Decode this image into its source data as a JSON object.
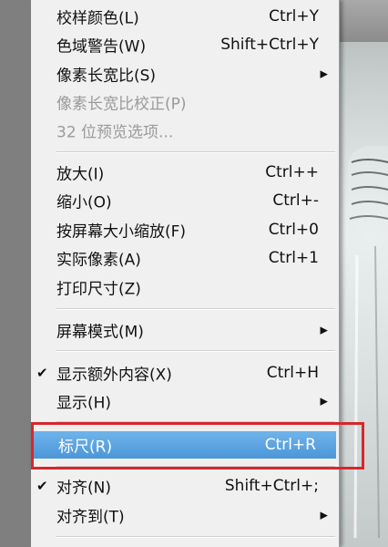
{
  "menu": {
    "items": [
      {
        "label": "校样颜色(L)",
        "shortcut": "Ctrl+Y",
        "enabled": true
      },
      {
        "label": "色域警告(W)",
        "shortcut": "Shift+Ctrl+Y",
        "enabled": true
      },
      {
        "label": "像素长宽比(S)",
        "shortcut": "",
        "submenu": true,
        "enabled": true
      },
      {
        "label": "像素长宽比校正(P)",
        "shortcut": "",
        "enabled": false
      },
      {
        "label": "32 位预览选项...",
        "shortcut": "",
        "enabled": false
      },
      {
        "label": "放大(I)",
        "shortcut": "Ctrl++",
        "enabled": true
      },
      {
        "label": "缩小(O)",
        "shortcut": "Ctrl+-",
        "enabled": true
      },
      {
        "label": "按屏幕大小缩放(F)",
        "shortcut": "Ctrl+0",
        "enabled": true
      },
      {
        "label": "实际像素(A)",
        "shortcut": "Ctrl+1",
        "enabled": true
      },
      {
        "label": "打印尺寸(Z)",
        "shortcut": "",
        "enabled": true
      },
      {
        "label": "屏幕模式(M)",
        "shortcut": "",
        "submenu": true,
        "enabled": true
      },
      {
        "label": "显示额外内容(X)",
        "shortcut": "Ctrl+H",
        "checked": true,
        "enabled": true
      },
      {
        "label": "显示(H)",
        "shortcut": "",
        "submenu": true,
        "enabled": true
      },
      {
        "label": "标尺(R)",
        "shortcut": "Ctrl+R",
        "highlighted": true,
        "enabled": true
      },
      {
        "label": "对齐(N)",
        "shortcut": "Shift+Ctrl+;",
        "checked": true,
        "enabled": true
      },
      {
        "label": "对齐到(T)",
        "shortcut": "",
        "submenu": true,
        "enabled": true
      }
    ],
    "check_glyph": "✔",
    "submenu_glyph": "▶"
  },
  "colors": {
    "menu_bg": "#f0f0f0",
    "highlight": "#5aa3e0",
    "annotation_box": "#d9262b",
    "disabled_text": "#9a9a9a"
  }
}
